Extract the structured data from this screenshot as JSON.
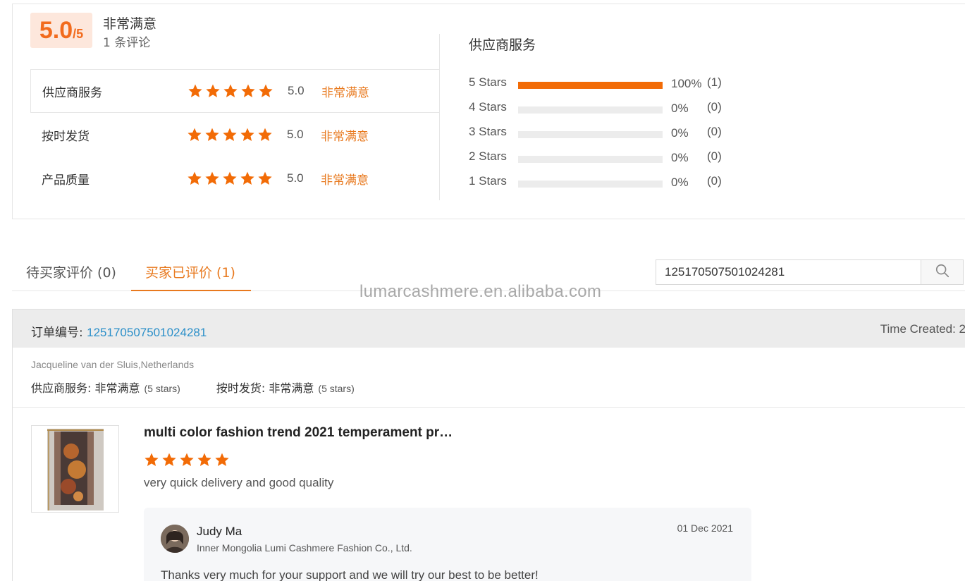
{
  "summary": {
    "score": "5.0",
    "score_max": "/5",
    "overall_level": "非常满意",
    "review_count": "1 条评论",
    "categories": [
      {
        "name": "供应商服务",
        "stars": 5,
        "score": "5.0",
        "level": "非常满意"
      },
      {
        "name": "按时发货",
        "stars": 5,
        "score": "5.0",
        "level": "非常满意"
      },
      {
        "name": "产品质量",
        "stars": 5,
        "score": "5.0",
        "level": "非常满意"
      }
    ]
  },
  "distribution": {
    "title": "供应商服务",
    "rows": [
      {
        "label": "5  Stars",
        "fraction": 1.0,
        "percent": "100%",
        "count": "(1)"
      },
      {
        "label": "4  Stars",
        "fraction": 0.0,
        "percent": "0%",
        "count": "(0)"
      },
      {
        "label": "3  Stars",
        "fraction": 0.0,
        "percent": "0%",
        "count": "(0)"
      },
      {
        "label": "2  Stars",
        "fraction": 0.0,
        "percent": "0%",
        "count": "(0)"
      },
      {
        "label": "1  Stars",
        "fraction": 0.0,
        "percent": "0%",
        "count": "(0)"
      }
    ]
  },
  "tabs": {
    "pending": "待买家评价 (0)",
    "reviewed": "买家已评价 (1)"
  },
  "search": {
    "value": "125170507501024281"
  },
  "watermark": "lumarcashmere.en.alibaba.com",
  "order": {
    "number_label": "订单编号: ",
    "number": "125170507501024281",
    "time_created": "Time Created: 2",
    "buyer": "Jacqueline van der Sluis,Netherlands",
    "ratings": [
      {
        "label": "供应商服务: 非常满意",
        "stars_text": "(5 stars)"
      },
      {
        "label": "按时发货: 非常满意",
        "stars_text": "(5 stars)"
      }
    ],
    "product": {
      "title": "multi color fashion trend 2021 temperament pr…",
      "stars": 5,
      "comment": "very quick delivery and good quality"
    },
    "reply": {
      "name": "Judy Ma",
      "company": "Inner Mongolia Lumi Cashmere Fashion Co., Ltd.",
      "date": "01 Dec 2021",
      "text": "Thanks very much for your support and we will try our best to be better!"
    }
  },
  "colors": {
    "accent": "#f26b06",
    "level_text": "#e8791e",
    "link": "#2b8fc9"
  }
}
